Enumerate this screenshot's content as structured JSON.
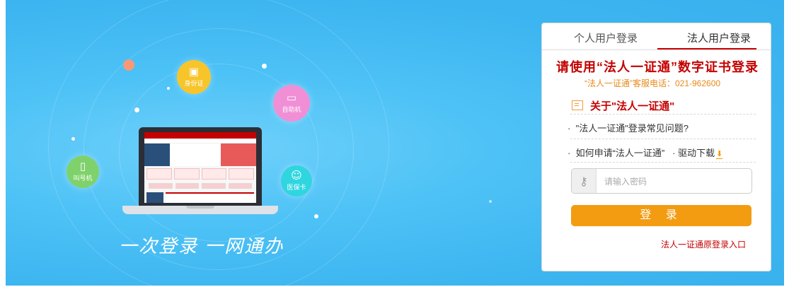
{
  "banner": {
    "slogan": "一次登录  一网通办",
    "bubbles": {
      "id_card": {
        "label": "身份证",
        "icon": "id-card-icon"
      },
      "kiosk": {
        "label": "自助机",
        "icon": "monitor-icon"
      },
      "queue": {
        "label": "叫号机",
        "icon": "queue-machine-icon"
      },
      "medical": {
        "label": "医保卡",
        "icon": "medical-card-icon"
      }
    },
    "colors": {
      "background": "#3db5f0",
      "id_card": "#f7c52a",
      "kiosk": "#f08fd6",
      "queue": "#7fd26b",
      "medical": "#2fd6e0",
      "accent_dot": "#f59a78"
    }
  },
  "login_panel": {
    "tabs": [
      {
        "label": "个人用户登录",
        "active": false
      },
      {
        "label": "法人用户登录",
        "active": true
      }
    ],
    "headline": "请使用“法人一证通”数字证书登录",
    "hotline": "“法人一证通”客服电话：021-962600",
    "about_title": "关于\"法人一证通\"",
    "links": {
      "faq": "\"法人一证通\"登录常见问题?",
      "apply": "如何申请“法人一证通”",
      "driver": "驱动下载"
    },
    "password": {
      "placeholder": "请输入密码",
      "value": ""
    },
    "login_label": "登 录",
    "legacy_entry": "法人一证通原登录入口",
    "colors": {
      "accent_red": "#c40000",
      "button": "#f39c12",
      "hotline": "#e88a1a"
    }
  }
}
